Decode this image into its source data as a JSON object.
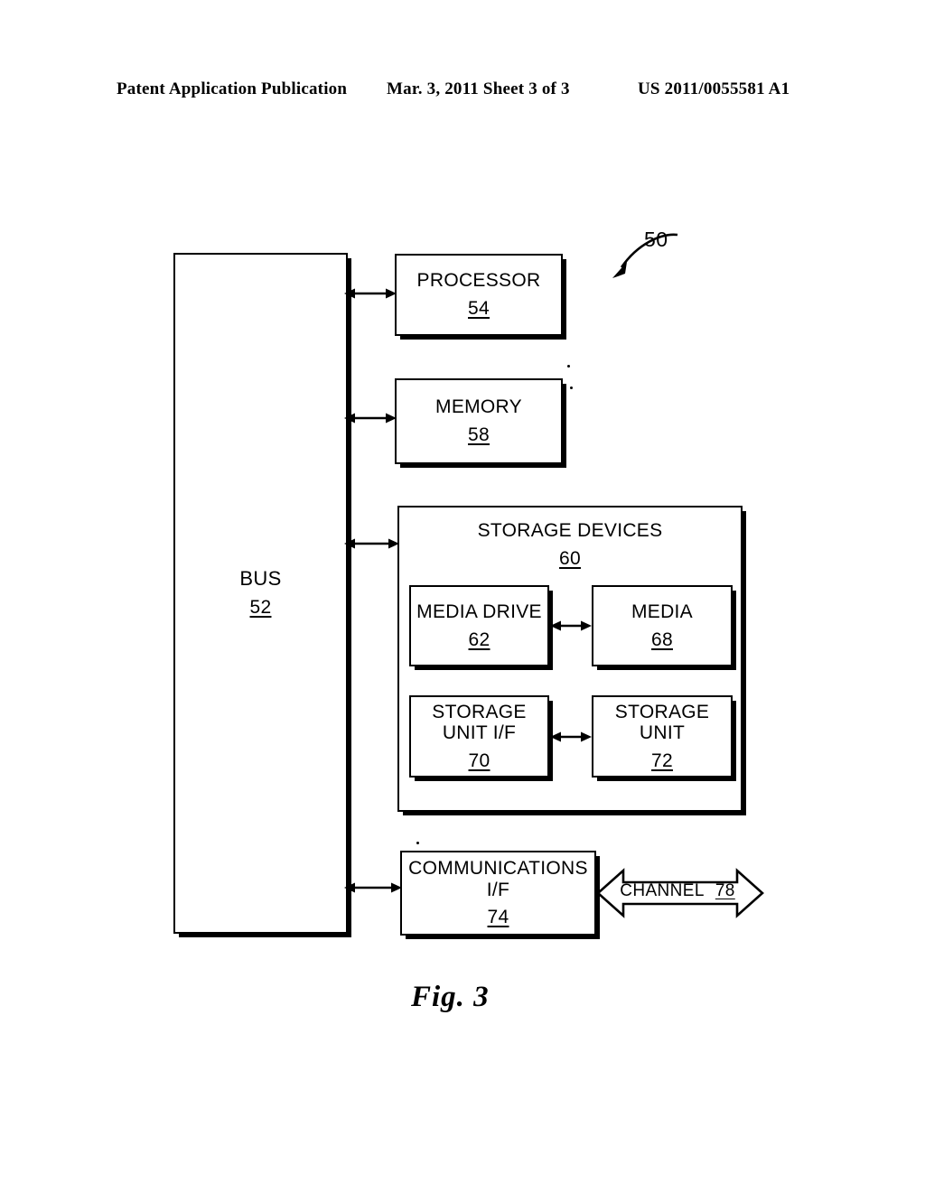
{
  "header": {
    "left": "Patent Application Publication",
    "middle": "Mar. 3, 2011   Sheet 3 of 3",
    "right": "US 2011/0055581 A1"
  },
  "figure": {
    "caption": "Fig. 3",
    "reference_numeral": "50"
  },
  "diagram": {
    "type": "block-diagram",
    "bus": {
      "title": "BUS",
      "number": "52"
    },
    "processor": {
      "title": "PROCESSOR",
      "number": "54"
    },
    "memory": {
      "title": "MEMORY",
      "number": "58"
    },
    "storage_devices": {
      "title": "STORAGE DEVICES",
      "number": "60"
    },
    "media_drive": {
      "title": "MEDIA DRIVE",
      "number": "62"
    },
    "media": {
      "title": "MEDIA",
      "number": "68"
    },
    "storage_unit_if": {
      "title": "STORAGE\nUNIT I/F",
      "number": "70"
    },
    "storage_unit": {
      "title": "STORAGE\nUNIT",
      "number": "72"
    },
    "communications_if": {
      "title": "COMMUNICATIONS\nI/F",
      "number": "74"
    },
    "channel": {
      "title": "CHANNEL",
      "number": "78"
    }
  },
  "colors": {
    "ink": "#000000",
    "paper": "#ffffff"
  }
}
